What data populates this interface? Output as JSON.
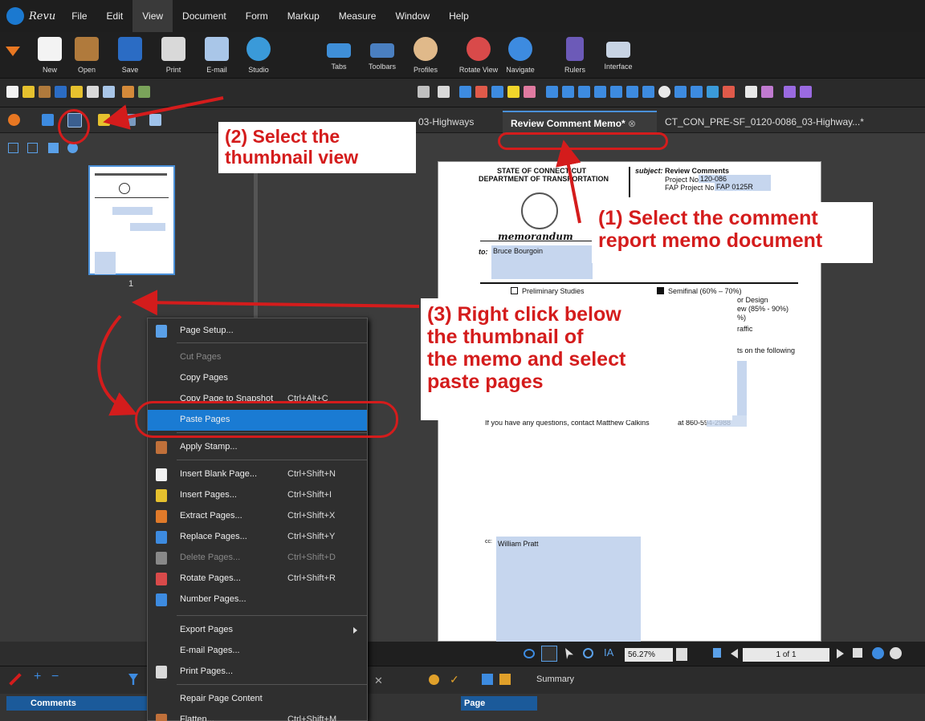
{
  "menubar": {
    "brand": "Revu",
    "items": [
      "File",
      "Edit",
      "View",
      "Document",
      "Form",
      "Markup",
      "Measure",
      "Window",
      "Help"
    ],
    "active": "View"
  },
  "ribbon": {
    "buttons": [
      "New",
      "Open",
      "Save",
      "Print",
      "E-mail",
      "Studio",
      "Tabs",
      "Toolbars",
      "Profiles",
      "Rotate View",
      "Navigate",
      "Rulers",
      "Interface"
    ]
  },
  "tabs": {
    "left_truncated": "03-Highways",
    "active": "Review Comment Memo*",
    "right": "CT_CON_PRE-SF_0120-0086_03-Highway...*"
  },
  "thumbnail": {
    "page_label": "1"
  },
  "document": {
    "dept_line1": "STATE OF CONNECTICUT",
    "dept_line2": "DEPARTMENT OF TRANSPORTATION",
    "subject_label": "subject:",
    "subject_value": "Review Comments",
    "project_no_label": "Project No.",
    "project_no_value": "120-086",
    "fap_label": "FAP Project No.",
    "fap_value": "FAP 0125R",
    "memorandum": "memorandum",
    "to_label": "to:",
    "to_value": "Bruce Bourgoin",
    "prelim": "Preliminary Studies",
    "semifinal": "Semifinal (60% – 70%)",
    "frag1": "or Design",
    "frag2": "ew (85% - 90%)",
    "frag3": "%)",
    "frag4": "raffic",
    "frag5": "ts on the following",
    "questions": "If you have any questions, contact Matthew Calkins",
    "phone": "at 860-594-2988",
    "cc_label": "cc:",
    "cc_value": "William Pratt"
  },
  "context_menu": {
    "items": [
      {
        "label": "Page Setup...",
        "shortcut": "",
        "disabled": false,
        "highlight": false
      },
      {
        "label": "Cut Pages",
        "shortcut": "",
        "disabled": true,
        "highlight": false
      },
      {
        "label": "Copy Pages",
        "shortcut": "",
        "disabled": false,
        "highlight": false
      },
      {
        "label": "Copy Page to Snapshot",
        "shortcut": "Ctrl+Alt+C",
        "disabled": false,
        "highlight": false
      },
      {
        "label": "Paste Pages",
        "shortcut": "",
        "disabled": false,
        "highlight": true
      },
      {
        "label": "Apply Stamp...",
        "shortcut": "",
        "disabled": false,
        "highlight": false
      },
      {
        "label": "Insert Blank Page...",
        "shortcut": "Ctrl+Shift+N",
        "disabled": false,
        "highlight": false
      },
      {
        "label": "Insert Pages...",
        "shortcut": "Ctrl+Shift+I",
        "disabled": false,
        "highlight": false
      },
      {
        "label": "Extract Pages...",
        "shortcut": "Ctrl+Shift+X",
        "disabled": false,
        "highlight": false
      },
      {
        "label": "Replace Pages...",
        "shortcut": "Ctrl+Shift+Y",
        "disabled": false,
        "highlight": false
      },
      {
        "label": "Delete Pages...",
        "shortcut": "Ctrl+Shift+D",
        "disabled": true,
        "highlight": false
      },
      {
        "label": "Rotate Pages...",
        "shortcut": "Ctrl+Shift+R",
        "disabled": false,
        "highlight": false
      },
      {
        "label": "Number Pages...",
        "shortcut": "",
        "disabled": false,
        "highlight": false
      },
      {
        "label": "Export Pages",
        "shortcut": "",
        "disabled": false,
        "highlight": false
      },
      {
        "label": "E-mail Pages...",
        "shortcut": "",
        "disabled": false,
        "highlight": false
      },
      {
        "label": "Print Pages...",
        "shortcut": "",
        "disabled": false,
        "highlight": false
      },
      {
        "label": "Repair Page Content",
        "shortcut": "",
        "disabled": false,
        "highlight": false
      },
      {
        "label": "Flatten...",
        "shortcut": "Ctrl+Shift+M",
        "disabled": false,
        "highlight": false
      }
    ]
  },
  "statusbar": {
    "zoom": "56.27%",
    "page": "1 of 1"
  },
  "bottom": {
    "summary": "Summary",
    "comments_header": "Comments",
    "page_col": "Page"
  },
  "annotations": {
    "step1_line1": "(1) Select the comment",
    "step1_line2": "report memo document",
    "step2_line1": "(2) Select the",
    "step2_line2": "thumbnail view",
    "step3_line1": "(3) Right click below",
    "step3_line2": "the thumbnail of",
    "step3_line3": "the memo and select",
    "step3_line4": "paste pages"
  },
  "colors": {
    "accent": "#1a7bd3",
    "annotation": "#d41c1c",
    "panel": "#3a3a3a"
  }
}
